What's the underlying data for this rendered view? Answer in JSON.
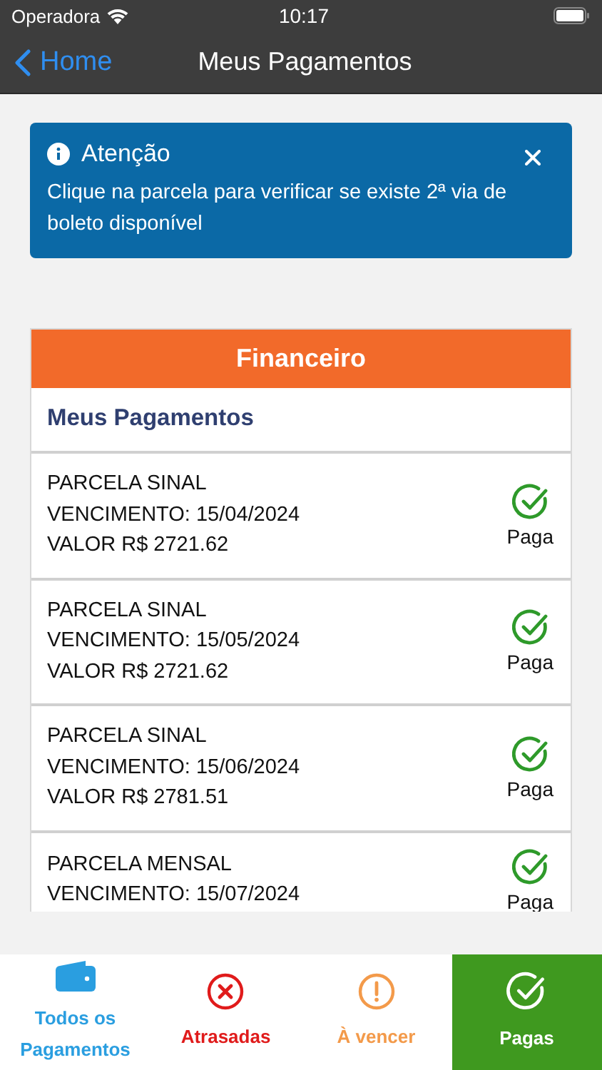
{
  "status_bar": {
    "carrier": "Operadora",
    "time": "10:17"
  },
  "nav_bar": {
    "back": "Home",
    "title": "Meus Pagamentos"
  },
  "alert": {
    "title": "Atenção",
    "message": "Clique na parcela para verificar se existe 2ª via de boleto disponível"
  },
  "card": {
    "header": "Financeiro",
    "subtitle": "Meus Pagamentos"
  },
  "payments": [
    {
      "name": "PARCELA SINAL",
      "due": "VENCIMENTO: 15/04/2024",
      "value": "VALOR R$ 2721.62",
      "status": "Paga"
    },
    {
      "name": "PARCELA SINAL",
      "due": "VENCIMENTO: 15/05/2024",
      "value": "VALOR R$ 2721.62",
      "status": "Paga"
    },
    {
      "name": "PARCELA SINAL",
      "due": "VENCIMENTO: 15/06/2024",
      "value": "VALOR R$ 2781.51",
      "status": "Paga"
    },
    {
      "name": "PARCELA MENSAL",
      "due": "VENCIMENTO: 15/07/2024",
      "status": "Paga"
    }
  ],
  "tabs": [
    {
      "kind": "wallet",
      "label": "Todos os Pagamentos",
      "selected": false
    },
    {
      "kind": "overdue",
      "label": "Atrasadas",
      "selected": false
    },
    {
      "kind": "due",
      "label": "À vencer",
      "selected": false
    },
    {
      "kind": "paid",
      "label": "Pagas",
      "selected": true
    }
  ]
}
